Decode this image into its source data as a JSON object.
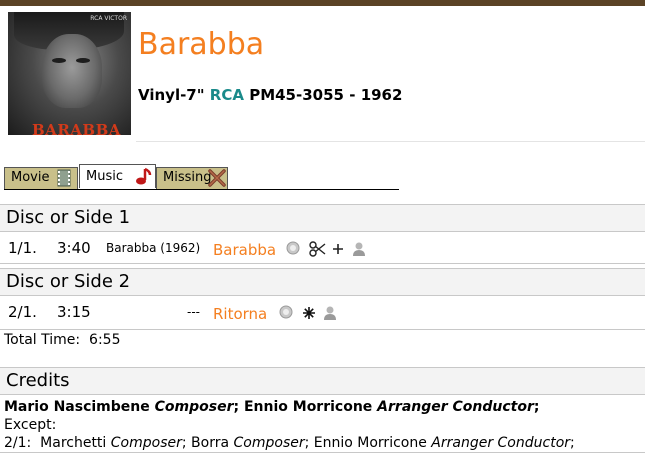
{
  "album": {
    "title": "Barabba",
    "format": "Vinyl-7\"",
    "label": "RCA",
    "catalog": "PM45-3055",
    "separator": "-",
    "year": "1962",
    "cover_text": "BARABBA",
    "cover_logo": "RCA VICTOR"
  },
  "tabs": [
    {
      "label": "Movie",
      "icon": "film-icon",
      "active": false
    },
    {
      "label": "Music",
      "icon": "music-note-icon",
      "active": true
    },
    {
      "label": "Missing",
      "icon": "cross-icon",
      "active": false
    }
  ],
  "sides": [
    {
      "heading": "Disc or Side 1",
      "tracks": [
        {
          "number": "1/1.",
          "time": "3:40",
          "note": "Barabba (1962)",
          "name": "Barabba",
          "icons": [
            "search-icon",
            "scissors-icon",
            "plus-icon",
            "person-icon"
          ]
        }
      ]
    },
    {
      "heading": "Disc or Side 2",
      "tracks": [
        {
          "number": "2/1.",
          "time": "3:15",
          "note": "---",
          "name": "Ritorna",
          "icons": [
            "search-icon",
            "asterisk-icon",
            "person-icon"
          ]
        }
      ]
    }
  ],
  "total": {
    "label": "Total Time:",
    "value": "6:55"
  },
  "credits": {
    "heading": "Credits",
    "line1": [
      {
        "name": "Mario Nascimbene",
        "role": "Composer",
        "sep": ";"
      },
      {
        "name": "Ennio Morricone",
        "role": "Arranger Conductor",
        "sep": ";"
      }
    ],
    "except_label": "Except:",
    "line3": {
      "prefix": "2/1:",
      "items": [
        {
          "name": "Marchetti",
          "role": "Composer",
          "sep": ";"
        },
        {
          "name": "Borra",
          "role": "Composer",
          "sep": ";"
        },
        {
          "name": "Ennio Morricone",
          "role": "Arranger Conductor",
          "sep": ";"
        }
      ]
    }
  },
  "colors": {
    "accent": "#f47f20",
    "label": "#1a8a8a",
    "topbar": "#5b4326",
    "tab_inactive": "#c9c08a"
  }
}
